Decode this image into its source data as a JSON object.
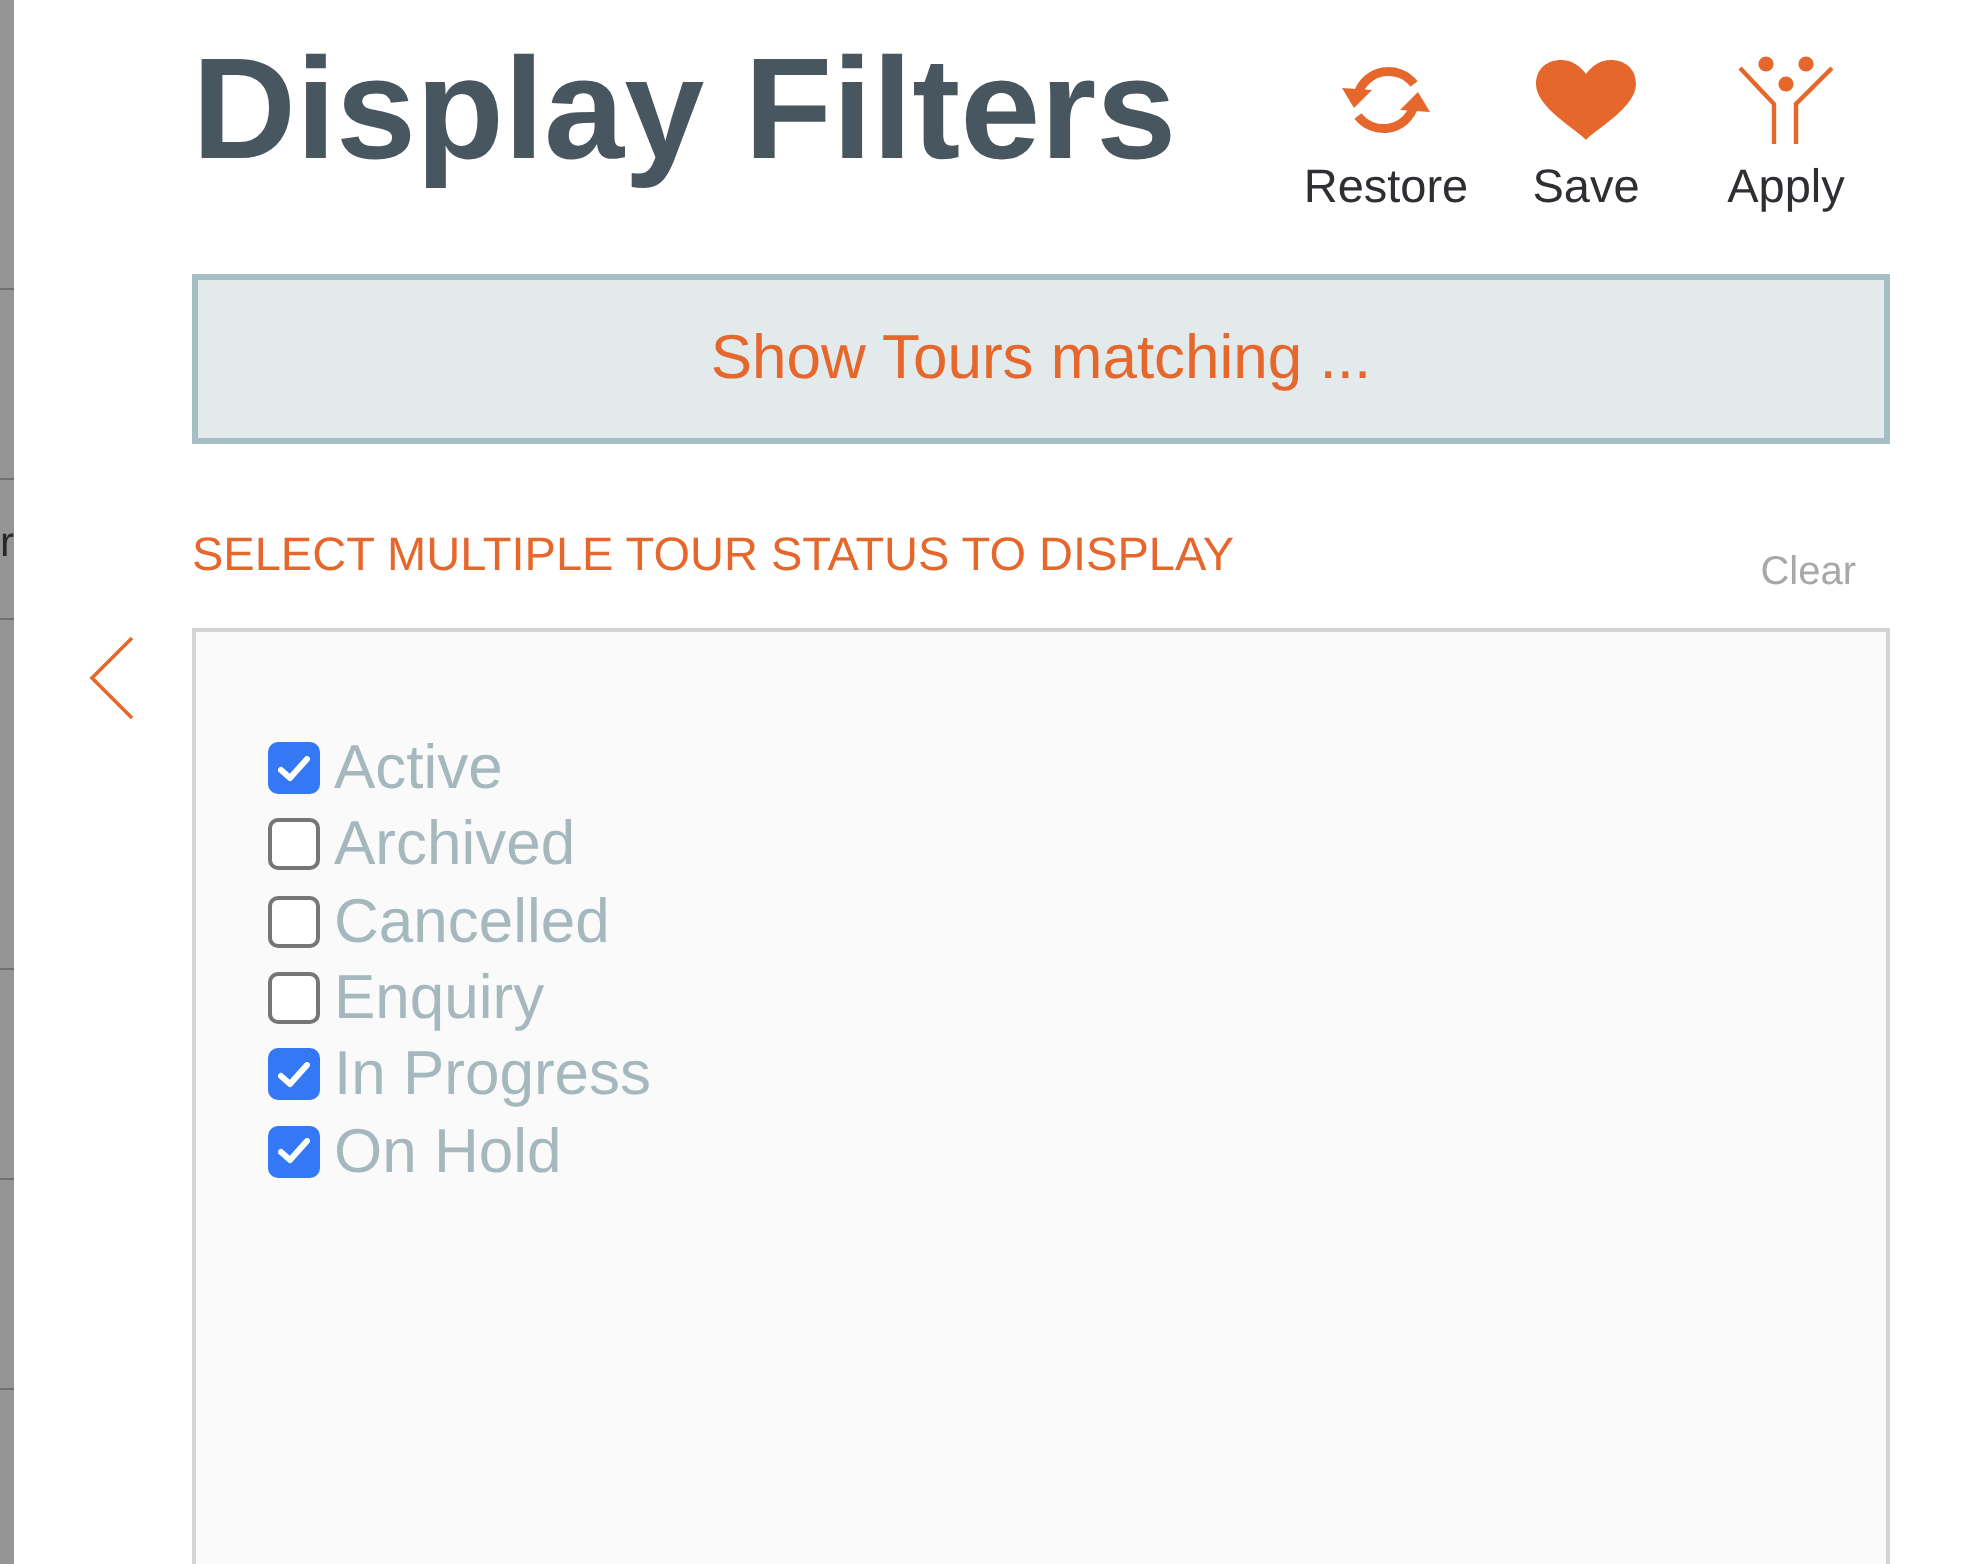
{
  "background_panel": {
    "text": "r"
  },
  "title": "Display Filters",
  "toolbar": [
    {
      "kind": "restore",
      "label": "Restore"
    },
    {
      "kind": "save",
      "label": "Save"
    },
    {
      "kind": "apply",
      "label": "Apply"
    }
  ],
  "banner": "Show Tours matching ...",
  "status_filter": {
    "heading": "SELECT MULTIPLE TOUR STATUS TO DISPLAY",
    "clear": "Clear",
    "options": [
      {
        "label": "Active",
        "checked": true
      },
      {
        "label": "Archived",
        "checked": false
      },
      {
        "label": "Cancelled",
        "checked": false
      },
      {
        "label": "Enquiry",
        "checked": false
      },
      {
        "label": "In Progress",
        "checked": true
      },
      {
        "label": "On Hold",
        "checked": true
      }
    ]
  }
}
